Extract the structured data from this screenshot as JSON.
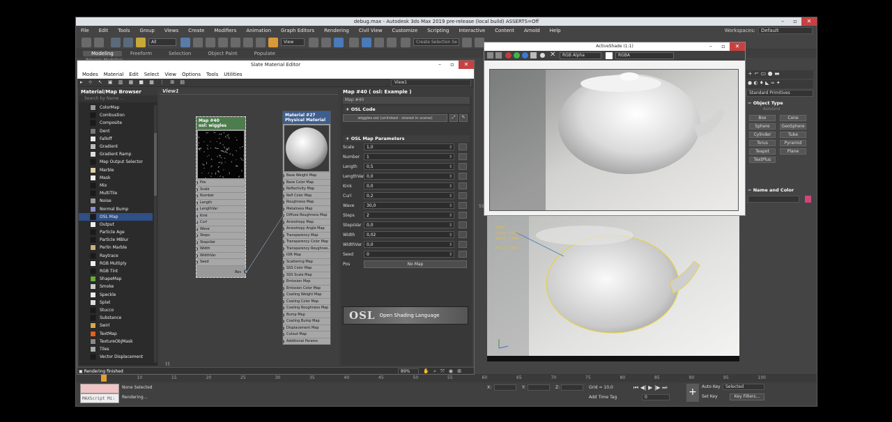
{
  "app": {
    "title": "debug.max - Autodesk 3ds Max 2019 pre-release  (local build) ASSERTS=Off",
    "menu": [
      "File",
      "Edit",
      "Tools",
      "Group",
      "Views",
      "Create",
      "Modifiers",
      "Animation",
      "Graph Editors",
      "Rendering",
      "Civil View",
      "Customize",
      "Scripting",
      "Interactive",
      "Content",
      "Arnold",
      "Help"
    ],
    "workspaces_label": "Workspaces:",
    "workspace_value": "Default",
    "selection_filter": "All",
    "view_dropdown": "View",
    "create_selection_set": "Create Selection Se",
    "ribbon_tabs": [
      "Modeling",
      "Freeform",
      "Selection",
      "Object Paint",
      "Populate"
    ],
    "ribbon_sub": "Polygon Modeling"
  },
  "command_panel": {
    "category": "Standard Primitives",
    "object_type_title": "Object Type",
    "autogrid": "AutoGrid",
    "buttons": [
      "Box",
      "Cone",
      "Sphere",
      "GeoSphere",
      "Cylinder",
      "Tube",
      "Torus",
      "Pyramid",
      "Teapot",
      "Plane",
      "TextPlus"
    ],
    "name_color_title": "Name and Color",
    "name_color_swatch": "#d0457a"
  },
  "viewport": {
    "stats": [
      "Total",
      "Polys:  3,840",
      "Verts:  7,906",
      "FPS:  27,000"
    ],
    "ruler_left": "55"
  },
  "timeline": {
    "ticks": [
      "5",
      "10",
      "15",
      "20",
      "25",
      "30",
      "35",
      "40",
      "45",
      "50",
      "55",
      "60",
      "65",
      "70",
      "75",
      "80",
      "85",
      "90",
      "95",
      "100"
    ]
  },
  "status": {
    "maxscript_label": "MAXScript Mi:",
    "none_selected": "None Selected",
    "rendering": "Rendering...",
    "x_label": "X:",
    "y_label": "Y:",
    "z_label": "Z:",
    "grid": "Grid = 10,0",
    "add_time_tag": "Add Time Tag",
    "auto_key": "Auto Key",
    "selected": "Selected",
    "set_key": "Set Key",
    "key_filters": "Key Filters...",
    "frame": "0"
  },
  "slate": {
    "title": "Slate Material Editor",
    "menu": [
      "Modes",
      "Material",
      "Edit",
      "Select",
      "View",
      "Options",
      "Tools",
      "Utilities"
    ],
    "view_dropdown": "View1",
    "browser_title": "Material/Map Browser",
    "search_placeholder": "Search by Name ...",
    "browser_items": [
      {
        "label": "ColorMap",
        "color": "#9a9a9a"
      },
      {
        "label": "Combustion",
        "color": "#1a1a1a"
      },
      {
        "label": "Composite",
        "color": "#1a1a1a"
      },
      {
        "label": "Dent",
        "color": "#777777"
      },
      {
        "label": "Falloff",
        "color": "#e8e8e8"
      },
      {
        "label": "Gradient",
        "color": "#bbbbbb"
      },
      {
        "label": "Gradient Ramp",
        "color": "#dddddd"
      },
      {
        "label": "Map Output Selector",
        "color": "#1a1a1a"
      },
      {
        "label": "Marble",
        "color": "#ddd0a8"
      },
      {
        "label": "Mask",
        "color": "#eeeeee"
      },
      {
        "label": "Mix",
        "color": "#1a1a1a"
      },
      {
        "label": "MultiTile",
        "color": "#1a1a1a"
      },
      {
        "label": "Noise",
        "color": "#999999"
      },
      {
        "label": "Normal Bump",
        "color": "#8c8ccc"
      },
      {
        "label": "OSL Map",
        "color": "#1a1a1a"
      },
      {
        "label": "Output",
        "color": "#eeeeee"
      },
      {
        "label": "Particle Age",
        "color": "#1a1a1a"
      },
      {
        "label": "Particle MBlur",
        "color": "#1a1a1a"
      },
      {
        "label": "Perlin Marble",
        "color": "#c8b080"
      },
      {
        "label": "Raytrace",
        "color": "#1a1a1a"
      },
      {
        "label": "RGB Multiply",
        "color": "#eeeeee"
      },
      {
        "label": "RGB Tint",
        "color": "#1a1a1a"
      },
      {
        "label": "ShapeMap",
        "color": "#6aaa3a"
      },
      {
        "label": "Smoke",
        "color": "#cccccc"
      },
      {
        "label": "Speckle",
        "color": "#eeeeee"
      },
      {
        "label": "Splat",
        "color": "#dddddd"
      },
      {
        "label": "Stucco",
        "color": "#1a1a1a"
      },
      {
        "label": "Substance",
        "color": "#1a1a1a"
      },
      {
        "label": "Swirl",
        "color": "#d8a848"
      },
      {
        "label": "TextMap",
        "color": "#e06020"
      },
      {
        "label": "TextureObjMask",
        "color": "#888888"
      },
      {
        "label": "Tiles",
        "color": "#aaaaaa"
      },
      {
        "label": "Vector Displacement",
        "color": "#1a1a1a"
      }
    ],
    "selected_index": 14,
    "view_tab": "View1",
    "node_map": {
      "title": "Map #40",
      "subtitle": "osl: wiggles",
      "slots": [
        "Pos",
        "Scale",
        "Number",
        "Length",
        "LengthVar",
        "Kink",
        "Curl",
        "Wave",
        "Steps",
        "StepsVar",
        "Width",
        "WidthVar",
        "Seed"
      ],
      "out": "Res"
    },
    "node_material": {
      "title": "Material #27",
      "subtitle": "Physical Material",
      "slots": [
        "Base Weight Map",
        "Base Color Map",
        "Reflectivity Map",
        "Refl Color Map",
        "Roughness Map",
        "Metalness Map",
        "Diffuse Roughness Map",
        "Anisotropy Map",
        "Anisotropy Angle Map",
        "Transparency Map",
        "Transparency Color Map",
        "Transparency Roughnes...",
        "IOR Map",
        "Scattering Map",
        "SSS Color Map",
        "SSS Scale Map",
        "Emission Map",
        "Emission Color Map",
        "Coating Weight Map",
        "Coating Color Map",
        "Coating Roughness Map",
        "Bump Map",
        "Coating Bump Map",
        "Displacement Map",
        "Cutout Map",
        "Additional Params"
      ]
    },
    "params": {
      "header": "Map #40  ( osl: Example )",
      "name": "Map #40",
      "osl_code_title": "OSL Code",
      "osl_code_value": "wiggles.osl (unlinked - stored in scene)",
      "params_title": "OSL Map Parameters",
      "rows": [
        {
          "label": "Scale",
          "value": "1,0"
        },
        {
          "label": "Number",
          "value": "1"
        },
        {
          "label": "Length",
          "value": "0,5"
        },
        {
          "label": "LengthVar",
          "value": "0,0"
        },
        {
          "label": "Kink",
          "value": "0,0"
        },
        {
          "label": "Curl",
          "value": "0,2"
        },
        {
          "label": "Wave",
          "value": "30,0"
        },
        {
          "label": "Steps",
          "value": "2"
        },
        {
          "label": "StepsVar",
          "value": "0,0"
        },
        {
          "label": "Width",
          "value": "0,02"
        },
        {
          "label": "WidthVar",
          "value": "0,0"
        },
        {
          "label": "Seed",
          "value": "0"
        }
      ],
      "pos_label": "Pos",
      "pos_value": "No Map",
      "osl_logo_big": "OSL",
      "osl_logo_small": "Open Shading Language"
    },
    "zoom": "89%",
    "status": "Rendering finished"
  },
  "active_shade": {
    "title": "ActiveShade (1:1)",
    "channel": "RGB Alpha",
    "display": "RGBA"
  }
}
